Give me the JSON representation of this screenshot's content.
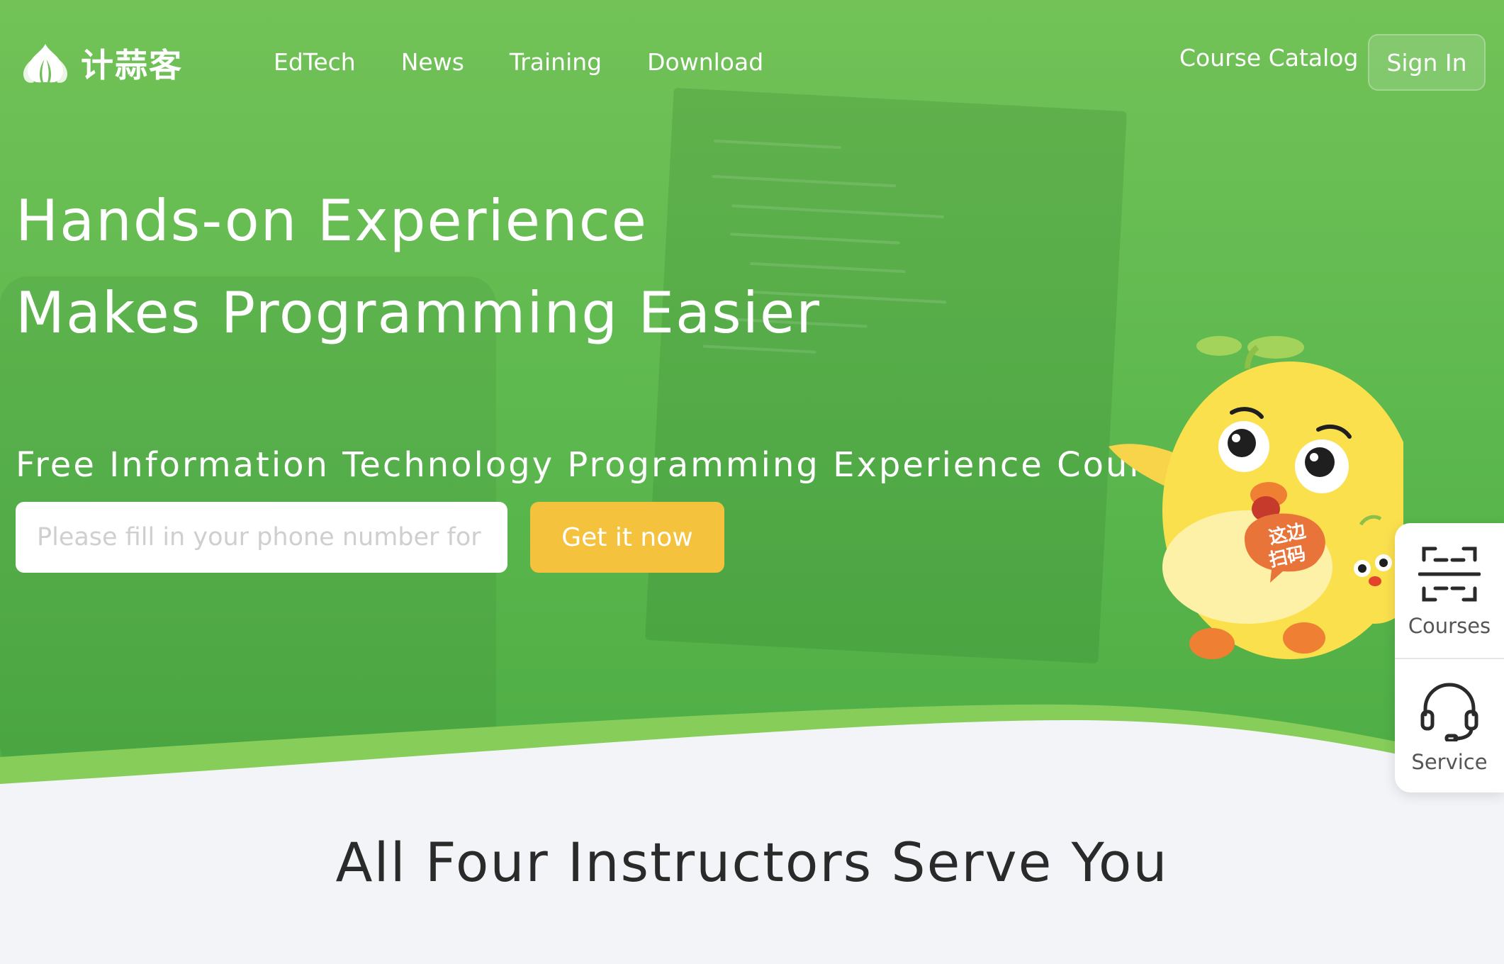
{
  "brand": {
    "name": "计蒜客",
    "primary_color": "#5cb84e",
    "accent_color": "#f5c23e"
  },
  "nav": {
    "links": [
      "EdTech",
      "News",
      "Training",
      "Download"
    ],
    "catalog": "Course Catalog",
    "sign_in": "Sign In"
  },
  "hero": {
    "headline_line1": "Hands-on Experience",
    "headline_line2": "Makes Programming Easier",
    "subheadline": "Free Information Technology Programming Experience Course",
    "phone_placeholder": "Please fill in your phone number for",
    "cta_label": "Get it now",
    "mascot_badge": "这边扫码"
  },
  "side_panel": {
    "items": [
      {
        "label": "Courses",
        "icon": "scan-icon"
      },
      {
        "label": "Service",
        "icon": "headset-icon"
      }
    ]
  },
  "section": {
    "title": "All Four Instructors Serve You"
  }
}
